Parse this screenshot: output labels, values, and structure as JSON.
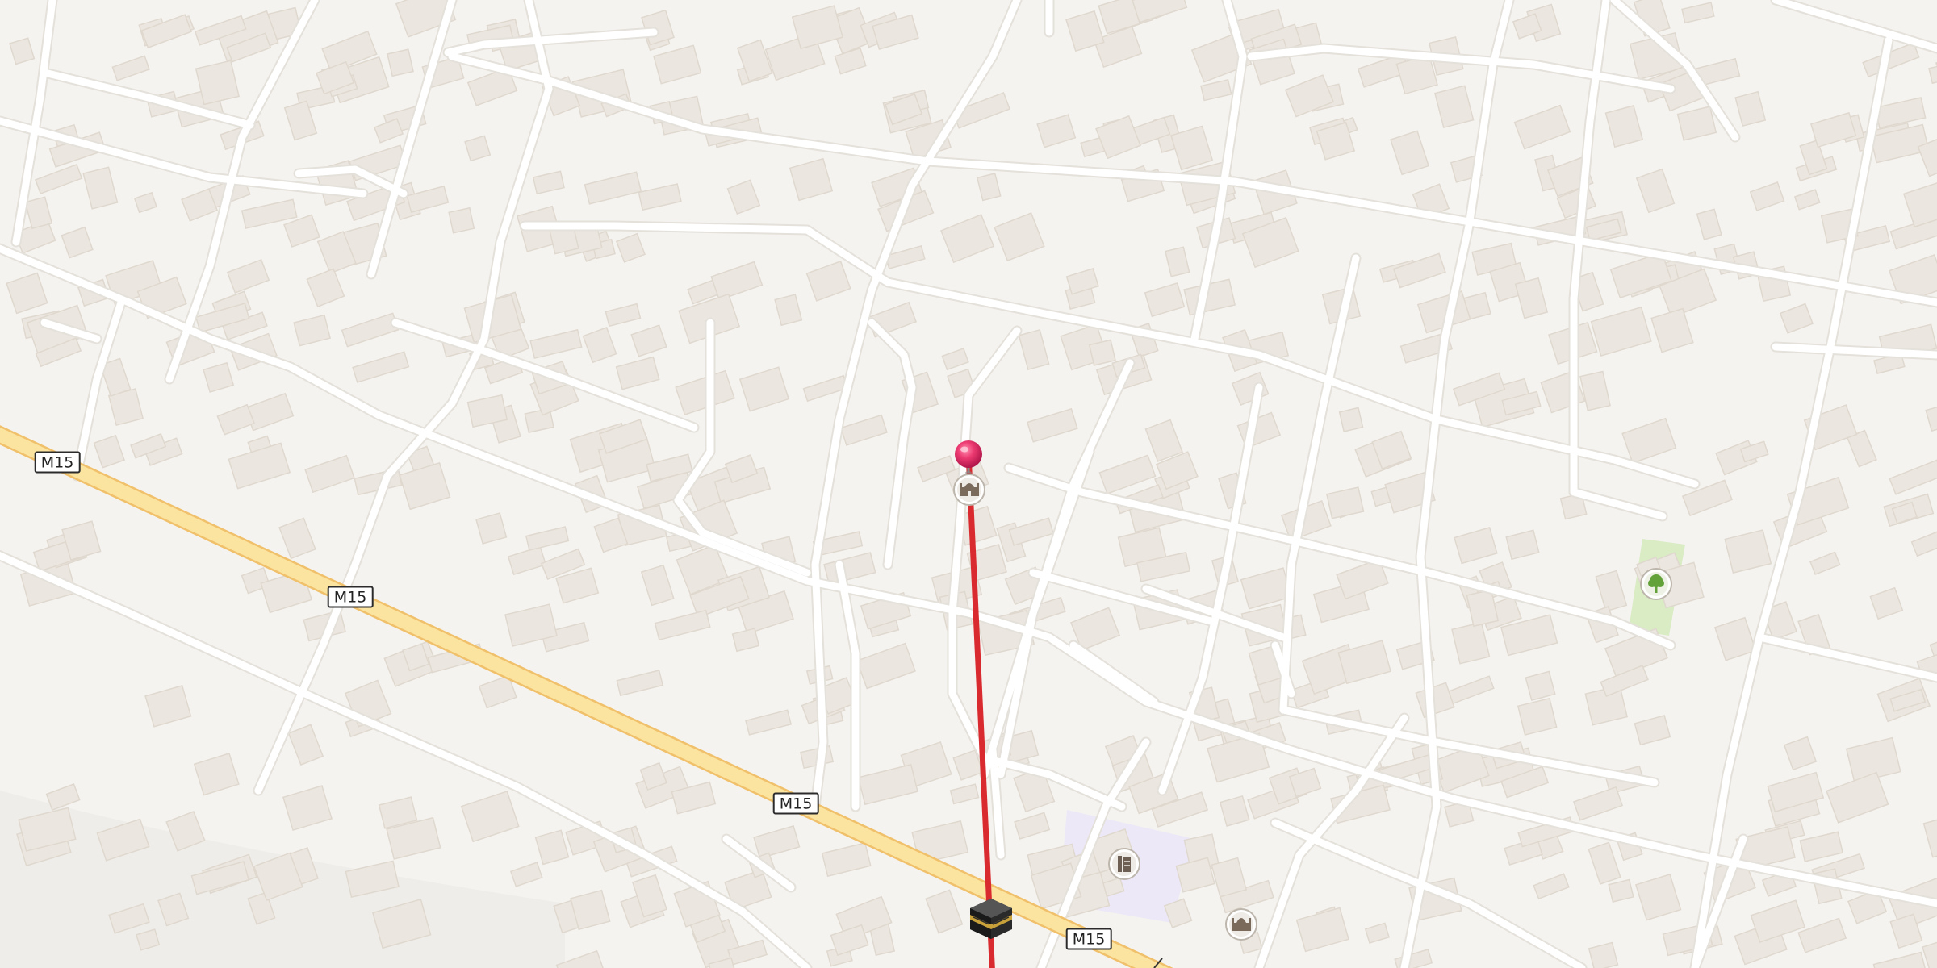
{
  "map": {
    "road_labels": [
      "M15",
      "M15",
      "M15",
      "M15"
    ],
    "icons": {
      "location_pin": "location-pin-icon",
      "qibla_marker": "kaaba-icon",
      "mosque_near_pin": "mosque-icon",
      "school": "school-icon",
      "mosque": "mosque-icon",
      "park": "tree-icon"
    },
    "colors": {
      "background": "#f5f3f0",
      "building": "#ebe6df",
      "road": "#ffffff",
      "highway": "#fbe3a0",
      "highway_edge": "#f0c06a",
      "qibla_line": "#d92b2f",
      "pin": "#e8306b",
      "park": "#d9ecc4",
      "school_area": "#ece8f7"
    }
  }
}
